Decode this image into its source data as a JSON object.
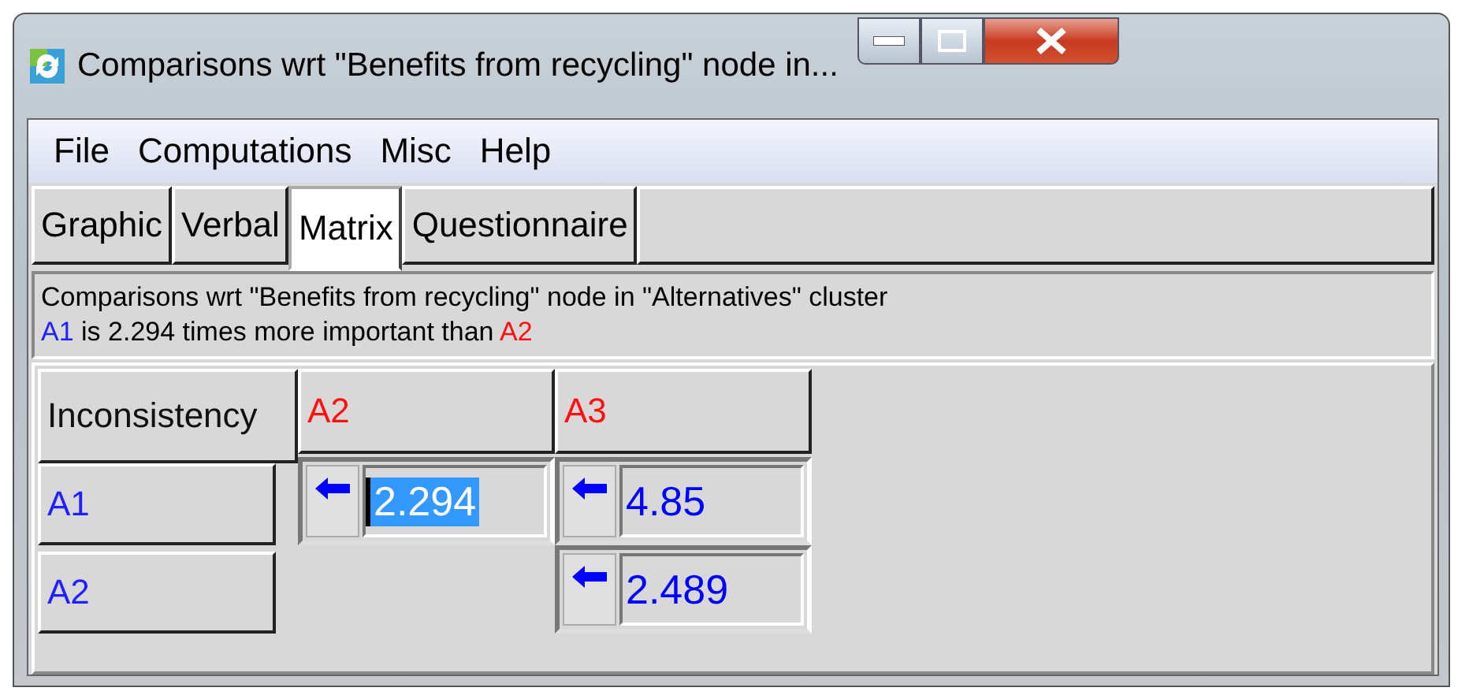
{
  "window": {
    "title": "Comparisons wrt \"Benefits from recycling\" node in..."
  },
  "menu": [
    "File",
    "Computations",
    "Misc",
    "Help"
  ],
  "tabs": [
    {
      "label": "Graphic",
      "selected": false
    },
    {
      "label": "Verbal",
      "selected": false
    },
    {
      "label": "Matrix",
      "selected": true
    },
    {
      "label": "Questionnaire",
      "selected": false
    }
  ],
  "info": {
    "line1": "Comparisons wrt \"Benefits from recycling\" node in \"Alternatives\" cluster",
    "line2": [
      {
        "text": "A1",
        "color": "#2020ff"
      },
      {
        "text": " is 2.294 times more important than "
      },
      {
        "text": "A2",
        "color": "#ff1010"
      }
    ]
  },
  "matrix": {
    "corner": "Inconsistency",
    "columns": [
      {
        "label": "A2",
        "color": "#ff1010"
      },
      {
        "label": "A3",
        "color": "#ff1010"
      }
    ],
    "rows": [
      {
        "label": "A1",
        "color": "#2020ff",
        "cells": [
          {
            "value": "2.294",
            "selected": true
          },
          {
            "value": "4.85",
            "selected": false
          }
        ]
      },
      {
        "label": "A2",
        "color": "#2020ff",
        "cells": [
          null,
          {
            "value": "2.489",
            "selected": false
          }
        ]
      }
    ]
  }
}
